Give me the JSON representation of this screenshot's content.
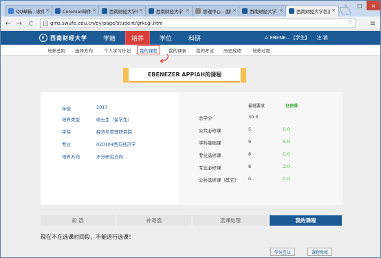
{
  "browser": {
    "tabs": [
      {
        "title": "QQ邮箱 - 收件箱",
        "color": "#3d7fd1"
      },
      {
        "title": "Coremail邮件系统",
        "color": "#2a5aa0"
      },
      {
        "title": "西南财经大学信息门户",
        "color": "#1c5a95"
      },
      {
        "title": "西南财经大学",
        "color": "#1c5a95"
      },
      {
        "title": "管理中心 - 国际教育",
        "color": "#888888"
      },
      {
        "title": "西南财经大学",
        "color": "#1c5a95"
      },
      {
        "title": "西南财经大学信息门户",
        "color": "#1c5a95"
      }
    ],
    "tab_close": "×",
    "url": "gms.swufe.edu.cn/py/page/student/grkcgl.htm",
    "back": "←",
    "forward": "→",
    "reload": "C",
    "star": "☆",
    "menu": "≡",
    "win_min": "–",
    "win_max": "□",
    "win_close": "×"
  },
  "header": {
    "logo_text": "西南财经大学",
    "nav": [
      {
        "label": "学籍"
      },
      {
        "label": "培养"
      },
      {
        "label": "学位"
      },
      {
        "label": "科研"
      }
    ],
    "user_icon": "⌂",
    "user_name": "EBENE...【学生】",
    "logout": "注 销"
  },
  "subnav": [
    {
      "label": "培养总则"
    },
    {
      "label": "选择方向"
    },
    {
      "label": "个人学习计划"
    },
    {
      "label": "我的课程"
    },
    {
      "label": "我的课表"
    },
    {
      "label": "我的考试"
    },
    {
      "label": "历史成绩"
    },
    {
      "label": "培养过程"
    }
  ],
  "page_title": "EBENEZER APPIAH的课程",
  "student": [
    {
      "key": "年级",
      "value": "2017"
    },
    {
      "key": "培养类型",
      "value": "硕士生（留学生）"
    },
    {
      "key": "学院",
      "value": "经济与管理研究院"
    },
    {
      "key": "专业",
      "value": "020104西方经济学"
    },
    {
      "key": "培养方向",
      "value": "不分研究方向"
    }
  ],
  "credits": {
    "col_required": "最低要求",
    "col_earned": "已获得",
    "rows": [
      {
        "name": "总学分",
        "required": "30.0",
        "earned": ""
      },
      {
        "name": "公共必修课",
        "required": "5",
        "earned": "0.0"
      },
      {
        "name": "学科基础课",
        "required": "9",
        "earned": "9.0"
      },
      {
        "name": "专业选修课",
        "required": "8",
        "earned": "0.0"
      },
      {
        "name": "专业必修课",
        "required": "8",
        "earned": "3.0"
      },
      {
        "name": "公共选修课（其它）",
        "required": "0",
        "earned": "0.0"
      }
    ]
  },
  "steps": [
    {
      "label": "初  选"
    },
    {
      "label": "补退选"
    },
    {
      "label": "选课处理"
    },
    {
      "label": "我的课程"
    }
  ],
  "notice": "现在不在选课时间段，不能进行选课！",
  "buttons": {
    "mutual": "学分互认",
    "exempt": "课程免修"
  },
  "colors": {
    "brand": "#1c5a95",
    "highlight": "#e13a36",
    "earned": "#3cae3a",
    "accent": "#f2b233"
  }
}
